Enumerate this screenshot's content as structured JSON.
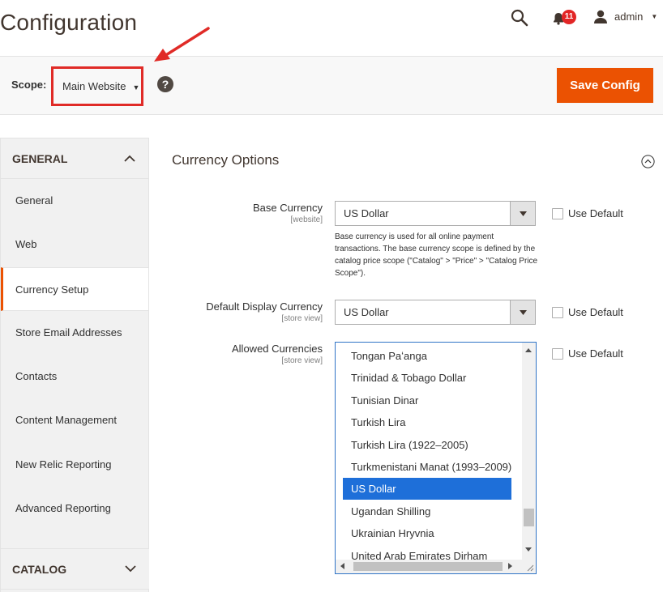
{
  "header": {
    "title": "Configuration",
    "notifications_count": "11",
    "user": "admin"
  },
  "scope": {
    "label": "Scope:",
    "value": "Main Website",
    "help": "?",
    "save_label": "Save Config"
  },
  "sidebar": {
    "general": "GENERAL",
    "items": [
      {
        "label": "General",
        "active": false
      },
      {
        "label": "Web",
        "active": false
      },
      {
        "label": "Currency Setup",
        "active": true
      },
      {
        "label": "Store Email Addresses",
        "active": false
      },
      {
        "label": "Contacts",
        "active": false
      },
      {
        "label": "Content Management",
        "active": false
      },
      {
        "label": "New Relic Reporting",
        "active": false
      },
      {
        "label": "Advanced Reporting",
        "active": false
      }
    ],
    "catalog": "CATALOG"
  },
  "main": {
    "section_title": "Currency Options",
    "base_currency": {
      "label": "Base Currency",
      "scope": "[website]",
      "value": "US Dollar",
      "use_default": "Use Default",
      "note": "Base currency is used for all online payment transactions. The base currency scope is defined by the catalog price scope (\"Catalog\" > \"Price\" > \"Catalog Price Scope\")."
    },
    "display_currency": {
      "label": "Default Display Currency",
      "scope": "[store view]",
      "value": "US Dollar",
      "use_default": "Use Default"
    },
    "allowed_currencies": {
      "label": "Allowed Currencies",
      "scope": "[store view]",
      "use_default": "Use Default",
      "options": [
        "Tongan Paʻanga",
        "Trinidad & Tobago Dollar",
        "Tunisian Dinar",
        "Turkish Lira",
        "Turkish Lira (1922–2005)",
        "Turkmenistani Manat (1993–2009)",
        "US Dollar",
        "Ugandan Shilling",
        "Ukrainian Hryvnia",
        "United Arab Emirates Dirham"
      ],
      "selected": "US Dollar"
    }
  },
  "colors": {
    "accent": "#eb5202",
    "annotation": "#e02b27",
    "selection": "#1e6fd9"
  }
}
